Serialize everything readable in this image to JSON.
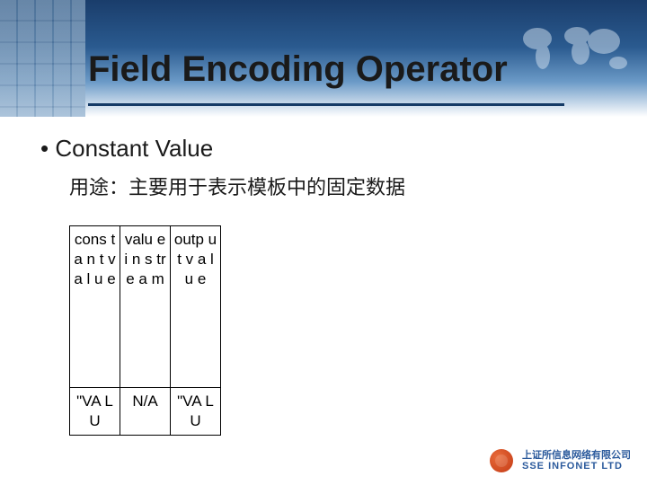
{
  "slide": {
    "title": "Field Encoding Operator",
    "bullet": "•  Constant Value",
    "subtext": "用途：主要用于表示模板中的固定数据"
  },
  "table": {
    "row1": {
      "c1": "cons t a n t v a l u e",
      "c2": "valu e i n s tr e a m",
      "c3": "outp u t v a l u e"
    },
    "row2": {
      "c1": "\"VA L U",
      "c2": "N/A",
      "c3": "\"VA L U"
    }
  },
  "footer": {
    "cn": "上证所信息网络有限公司",
    "en": "SSE INFONET LTD"
  }
}
